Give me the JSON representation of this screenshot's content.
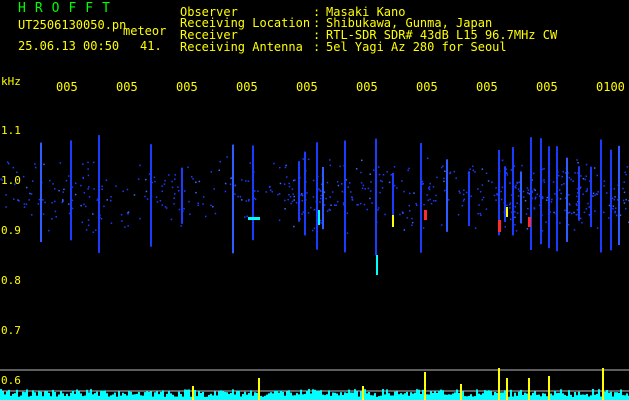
{
  "header": {
    "app_title": "HROFFT",
    "filename": "UT2506130050.pn",
    "tag": "meteor",
    "datetime": "25.06.13 00:50",
    "count": "41.",
    "observer_label": "Observer",
    "observer_value": "Masaki Kano",
    "location_label": "Receiving Location",
    "location_value": "Shibukawa, Gunma, Japan",
    "receiver_label": "Receiver",
    "receiver_value": "RTL-SDR SDR# 43dB L15 96.7MHz CW",
    "antenna_label": "Receiving Antenna",
    "antenna_value": "5el Yagi Az 280 for Seoul",
    "colon": ":"
  },
  "time_axis": {
    "labels": [
      "005",
      "005",
      "005",
      "005",
      "005",
      "005",
      "005",
      "005",
      "005",
      "0100"
    ]
  },
  "freq_axis": {
    "unit": "kHz",
    "labels": [
      "1.1",
      "1.0",
      "0.9",
      "0.8",
      "0.7",
      "0.6"
    ]
  },
  "colors": {
    "text_yellow": "#ffff00",
    "title_green": "#00ff00",
    "background": "#000000",
    "signal_blue": "#1a3cff",
    "signal_cyan": "#00ffff",
    "signal_red": "#ff2a2a",
    "echo_yellow": "#ffff00"
  }
}
